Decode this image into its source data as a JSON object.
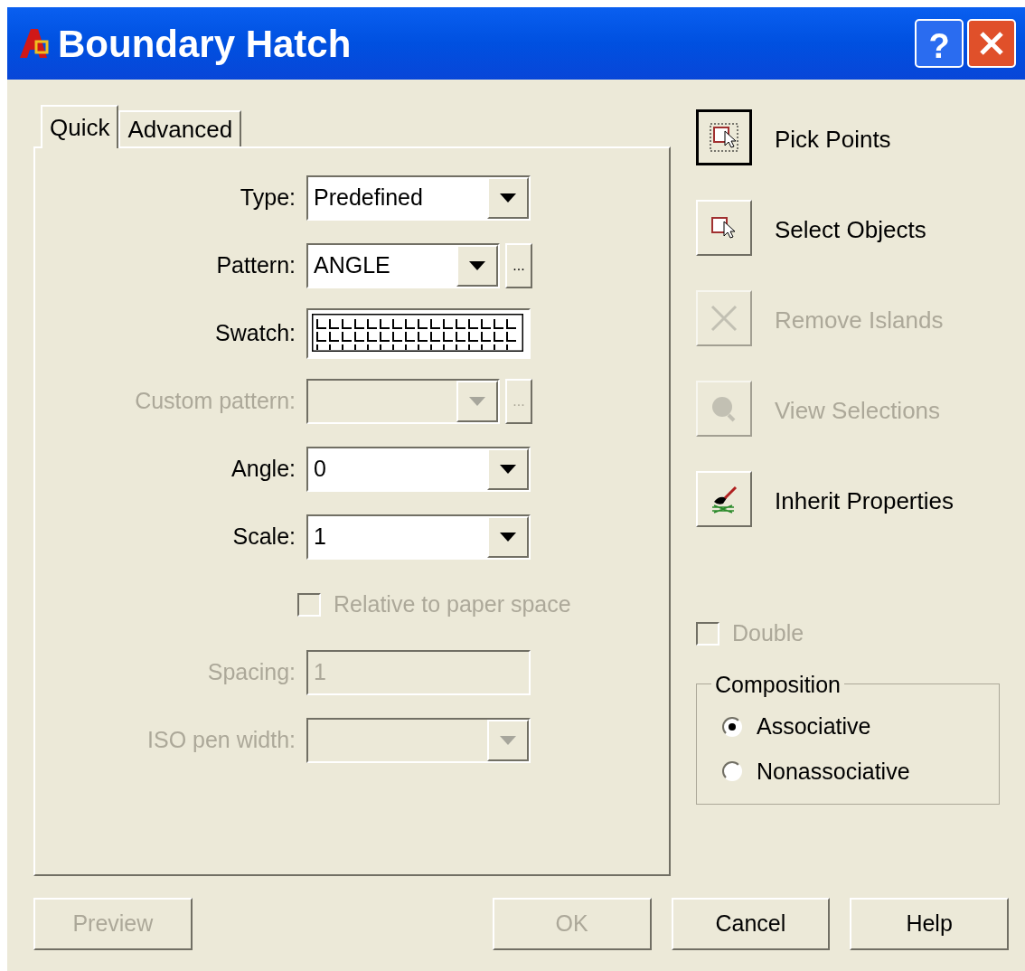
{
  "window": {
    "title": "Boundary Hatch",
    "help_button": "?"
  },
  "tabs": [
    {
      "label": "Quick",
      "selected": true
    },
    {
      "label": "Advanced",
      "selected": false
    }
  ],
  "fields": [
    {
      "kind": "dropdown",
      "label": "Type:",
      "value": "Predefined",
      "disabled": false
    },
    {
      "kind": "dropdown",
      "label": "Pattern:",
      "value": "ANGLE",
      "disabled": false,
      "browse": "..."
    },
    {
      "kind": "swatch",
      "label": "Swatch:"
    },
    {
      "kind": "dropdown",
      "label": "Custom pattern:",
      "disabled": true,
      "browse": "..."
    },
    {
      "kind": "dropdown",
      "label": "Angle:",
      "value": "0",
      "disabled": false
    },
    {
      "kind": "dropdown",
      "label": "Scale:",
      "value": "1",
      "disabled": false
    },
    {
      "kind": "checkbox",
      "label": "Relative to paper space",
      "disabled": true,
      "checked": false
    },
    {
      "kind": "text",
      "label": "Spacing:",
      "value": "1",
      "disabled": true
    },
    {
      "kind": "dropdown",
      "label": "ISO pen width:",
      "disabled": true
    }
  ],
  "actions": [
    {
      "kind": "pick",
      "label": "Pick Points",
      "disabled": false,
      "focused": true
    },
    {
      "kind": "select",
      "label": "Select Objects",
      "disabled": false,
      "focused": false
    },
    {
      "kind": "remove",
      "label": "Remove Islands",
      "disabled": true,
      "focused": false
    },
    {
      "kind": "view",
      "label": "View Selections",
      "disabled": true,
      "focused": false
    },
    {
      "kind": "inherit",
      "label": "Inherit Properties",
      "disabled": false,
      "focused": false
    }
  ],
  "double": {
    "label": "Double",
    "disabled": true,
    "checked": false
  },
  "composition": {
    "title": "Composition",
    "options": [
      {
        "label": "Associative",
        "selected": true
      },
      {
        "label": "Nonassociative",
        "selected": false
      }
    ]
  },
  "buttons": [
    {
      "label": "Preview",
      "disabled": true
    },
    {
      "label": "OK",
      "disabled": true
    },
    {
      "label": "Cancel",
      "disabled": false
    },
    {
      "label": "Help",
      "disabled": false
    }
  ]
}
